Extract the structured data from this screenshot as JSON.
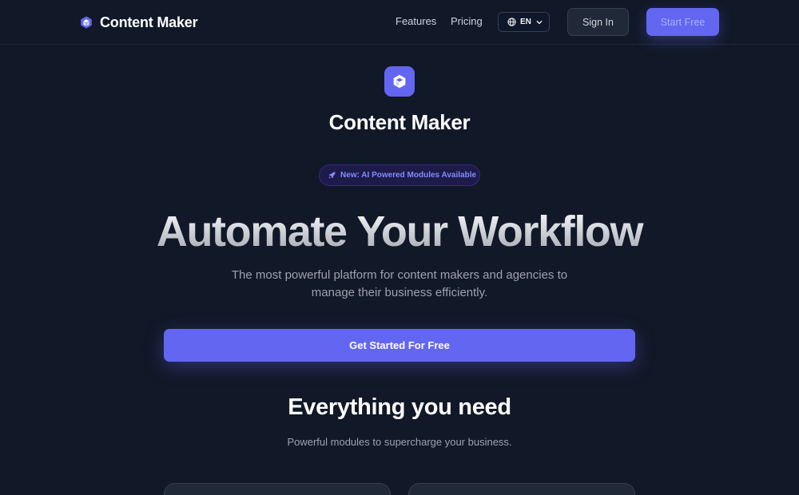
{
  "header": {
    "logo_text": "Content Maker",
    "logo_icon": "cube-icon",
    "nav": {
      "features": "Features",
      "pricing": "Pricing"
    },
    "language": {
      "selected": "EN",
      "icon": "globe-icon"
    },
    "sign_in_label": "Sign In",
    "start_free_label": "Start Free"
  },
  "hero": {
    "icon": "cube-icon",
    "brand_title": "Content Maker",
    "badge": {
      "icon": "rocket-icon",
      "text": "New: AI Powered Modules Available"
    },
    "headline": "Automate Your Workflow",
    "subtitle": "The most powerful platform for content makers and agencies to manage their business efficiently.",
    "cta_label": "Get Started For Free"
  },
  "features": {
    "title": "Everything you need",
    "subtitle": "Powerful modules to supercharge your business."
  },
  "colors": {
    "background": "#111827",
    "accent": "#6366f1",
    "accent_light": "#818cf8",
    "text_muted": "#9ca3af"
  }
}
